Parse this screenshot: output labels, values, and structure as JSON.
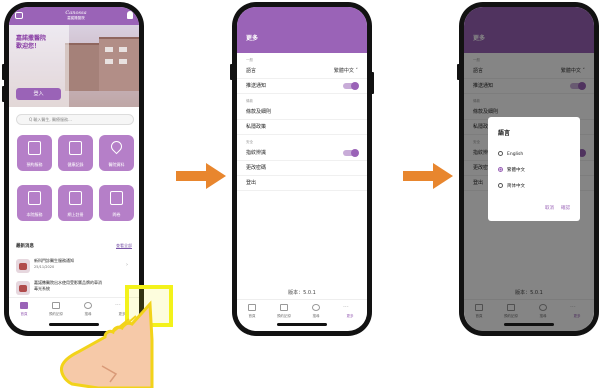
{
  "phone1": {
    "hero_title": "嘉諾撒醫院\n歡迎您！",
    "logo_script": "Canossa",
    "logo_name": "嘉諾撒醫院",
    "login_label": "登入",
    "search_placeholder": "Q  輸入醫生, 醫療服務…",
    "tiles": [
      "預約服務",
      "健康記錄",
      "醫院資料",
      "本院服務",
      "網上註冊",
      "問卷"
    ],
    "news_heading": "最新消息",
    "news_more": "查看全部",
    "news": [
      {
        "title": "新科門診醫生服務通知",
        "date": "25/11/2020"
      },
      {
        "title": "嘉諾撒醫院出水使用受影響品牌的車消毒光系統",
        "date": ""
      }
    ],
    "tabs": [
      "首頁",
      "預約記錄",
      "搜尋",
      "更多"
    ]
  },
  "phone2": {
    "title": "更多",
    "sections": [
      {
        "header": "一般",
        "rows": [
          {
            "label": "語言",
            "value": "繁體中文 ˅"
          },
          {
            "label": "推送通知",
            "toggle": true
          }
        ]
      },
      {
        "header": "條款",
        "rows": [
          {
            "label": "條款及細則"
          },
          {
            "label": "私隱政策"
          }
        ]
      },
      {
        "header": "安全",
        "rows": [
          {
            "label": "指紋辨識",
            "toggle": true
          },
          {
            "label": "更改密碼"
          },
          {
            "label": "登出"
          }
        ]
      }
    ],
    "version": "版本：5.0.1",
    "tabs": [
      "首頁",
      "預約記錄",
      "搜尋",
      "更多"
    ]
  },
  "phone3": {
    "title": "更多",
    "dialog_title": "語言",
    "options": [
      "English",
      "繁體中文",
      "简体中文"
    ],
    "selected": 1,
    "cancel": "取消",
    "confirm": "確認",
    "version": "版本：5.0.1"
  },
  "colors": {
    "brand": "#9a63b7",
    "arrow": "#e8862e",
    "highlight": "#f3f21a"
  }
}
